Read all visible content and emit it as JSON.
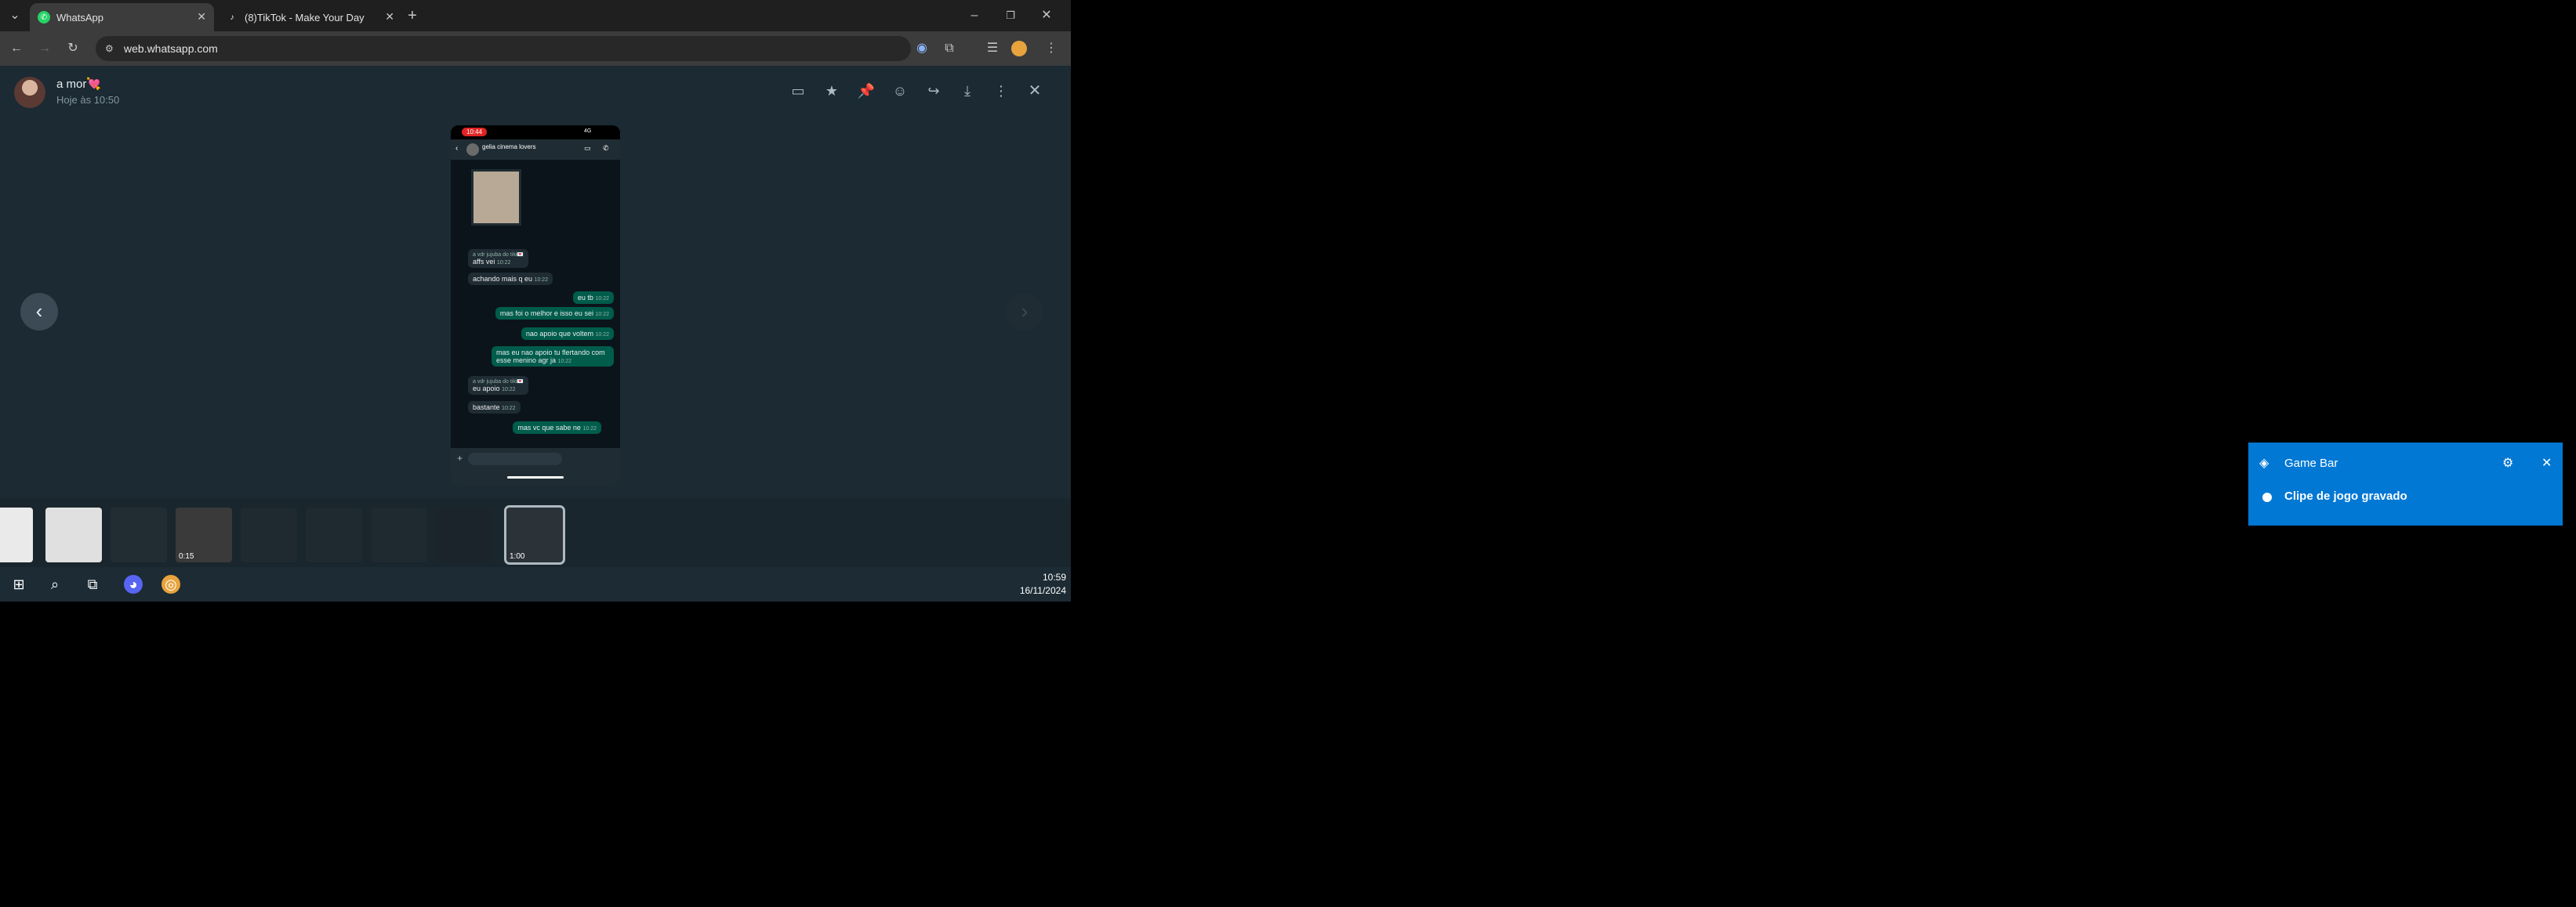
{
  "browser": {
    "tabs": [
      {
        "title": "WhatsApp",
        "active": true
      },
      {
        "title": "(8)TikTok - Make Your Day",
        "active": false
      }
    ],
    "url": "web.whatsapp.com"
  },
  "viewer": {
    "contact_name": "a mor💘",
    "timestamp": "Hoje às 10:50",
    "phone_screenshot": {
      "status_time": "10:44",
      "status_signal": "4G",
      "chat_name": "gelia cinema lovers",
      "messages": [
        {
          "dir": "in",
          "sender": "a vdr jujuba do tiki💌",
          "text": "affs vei",
          "time": "10:22"
        },
        {
          "dir": "in",
          "text": "achando mais q eu",
          "time": "10:22"
        },
        {
          "dir": "out",
          "text": "eu tb",
          "time": "10:22"
        },
        {
          "dir": "out",
          "text": "mas foi o melhor e isso eu sei",
          "time": "10:22"
        },
        {
          "dir": "out",
          "text": "nao apoio que voltem",
          "time": "10:22"
        },
        {
          "dir": "out",
          "text": "mas eu nao apoio tu flertando com esse menino agr ja",
          "time": "10:22"
        },
        {
          "dir": "in",
          "sender": "a vdr jujuba do tiki💌",
          "text": "eu apoio",
          "time": "10:22"
        },
        {
          "dir": "in",
          "text": "bastante",
          "time": "10:22"
        },
        {
          "dir": "out",
          "text": "mas vc que sabe ne",
          "time": "10:22"
        }
      ]
    },
    "thumbnails": [
      {
        "badge": ""
      },
      {
        "badge": ""
      },
      {
        "badge": ""
      },
      {
        "badge": "0:15"
      },
      {
        "badge": ""
      },
      {
        "badge": ""
      },
      {
        "badge": ""
      },
      {
        "badge": ""
      },
      {
        "badge": "1:00"
      }
    ]
  },
  "taskbar": {
    "time": "10:59",
    "date": "16/11/2024"
  },
  "gamebar": {
    "title": "Game Bar",
    "message": "Clipe de jogo gravado"
  },
  "colors": {
    "gamebar_bg": "#0078d4",
    "whatsapp_green": "#25d366",
    "outgoing_bubble": "#005c4b"
  }
}
